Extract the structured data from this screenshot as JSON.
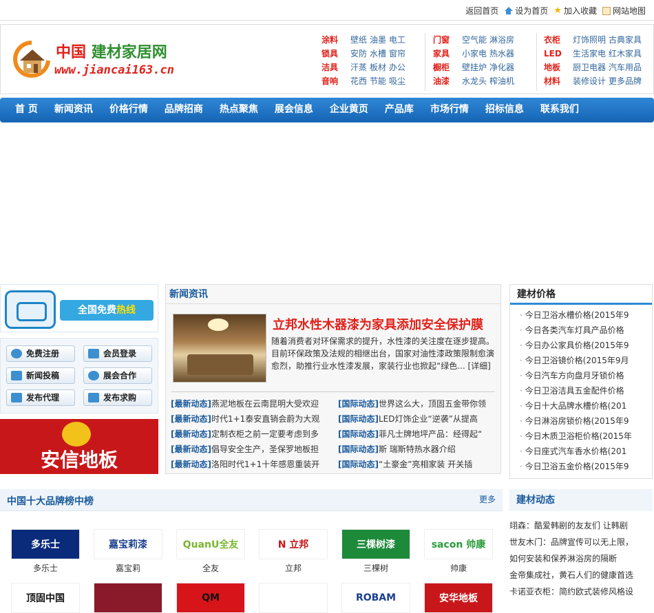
{
  "topbar": {
    "links": [
      "返回首页",
      "设为首页",
      "加入收藏",
      "网站地图"
    ]
  },
  "logo": {
    "title_red": "中国",
    "title_green": "建材家居网",
    "url": "www.jiancai163.cn"
  },
  "categories": [
    {
      "rows": [
        {
          "key": "涂料",
          "items": [
            "壁纸",
            "油墨",
            "电工"
          ]
        },
        {
          "key": "锁具",
          "items": [
            "安防",
            "水槽",
            "窗帘"
          ]
        },
        {
          "key": "洁具",
          "items": [
            "汗蒸",
            "板材",
            "办公"
          ]
        },
        {
          "key": "音响",
          "items": [
            "花西",
            "节能",
            "吸尘"
          ]
        }
      ]
    },
    {
      "rows": [
        {
          "key": "门窗",
          "items": [
            "空气能",
            "淋浴房"
          ]
        },
        {
          "key": "家具",
          "items": [
            "小家电",
            "热水器"
          ]
        },
        {
          "key": "橱柜",
          "items": [
            "壁挂炉",
            "净化器"
          ]
        },
        {
          "key": "油漆",
          "items": [
            "水龙头",
            "榨油机"
          ]
        }
      ]
    },
    {
      "rows": [
        {
          "key": "衣柜",
          "items": [
            "灯饰照明",
            "古典家具"
          ]
        },
        {
          "key": "LED",
          "items": [
            "生活家电",
            "红木家具"
          ]
        },
        {
          "key": "地板",
          "items": [
            "厨卫电器",
            "汽车用品"
          ]
        },
        {
          "key": "材料",
          "items": [
            "装修设计",
            "更多品牌"
          ]
        }
      ]
    }
  ],
  "nav": [
    "首 页",
    "新闻资讯",
    "价格行情",
    "品牌招商",
    "热点聚焦",
    "展会信息",
    "企业黄页",
    "产品库",
    "市场行情",
    "招标信息",
    "联系我们"
  ],
  "hotline": {
    "text_white": "全国免费",
    "text_yellow": "热线"
  },
  "user_buttons": [
    "免费注册",
    "会员登录",
    "新闻投稿",
    "展会合作",
    "发布代理",
    "发布求购"
  ],
  "anxin": {
    "brand": "安信地板"
  },
  "news": {
    "title": "新闻资讯",
    "featured_title": "立邦水性木器漆为家具添加安全保护膜",
    "featured_desc": "随着消费者对环保需求的提升，水性漆的关注度在逐步提高。目前环保政策及法规的相继出台，国家对油性漆政策限制愈演愈烈，助推行业水性漆发展，家装行业也掀起“绿色... [详细]",
    "left": [
      {
        "tag": "[最新动态]",
        "text": "燕泥地板在云南昆明大受欢迎"
      },
      {
        "tag": "[最新动态]",
        "text": "时代1+1泰安直销会蔚为大观"
      },
      {
        "tag": "[最新动态]",
        "text": "定制衣柜之前一定要考虑到多"
      },
      {
        "tag": "[最新动态]",
        "text": "倡导安全生产，圣保罗地板担"
      },
      {
        "tag": "[最新动态]",
        "text": "洛阳时代1+1十年感恩重装开"
      }
    ],
    "right": [
      {
        "tag": "[国际动态]",
        "text": "世界这么大，顶固五金带你领"
      },
      {
        "tag": "[国际动态]",
        "text": "LED灯饰企业“逆袭”从提高"
      },
      {
        "tag": "[国际动态]",
        "text": "菲凡士牌地坪产品：经得起“"
      },
      {
        "tag": "[国际动态]",
        "text": "斯 瑞斯特热水器介绍"
      },
      {
        "tag": "[国际动态]",
        "text": "“土豪金”亮相家装 开关插"
      }
    ]
  },
  "prices": {
    "title": "建材价格",
    "items": [
      "今日卫浴水槽价格(2015年9",
      "今日各类汽车灯具产品价格",
      "今日办公家具价格(2015年9",
      "今日卫浴镜价格(2015年9月",
      "今日汽车方向盘月牙锁价格",
      "今日卫浴洁具五金配件价格",
      "今日十大品牌水槽价格(201",
      "今日淋浴房锁价格(2015年9",
      "今日木质卫浴柜价格(2015年",
      "今日座式汽车香水价格(201",
      "今日卫浴五金价格(2015年9"
    ]
  },
  "dynamics": {
    "title": "建材动态",
    "items": [
      "翊森：酷爱韩剧的友友们 让韩剧",
      "世友木门：品牌宣传可以无上限，",
      "如何安装和保养淋浴房的隔断",
      "金帝集成社，黄石人们的健康首选",
      "卡诺亚衣柜：简约欧式装修风格设"
    ]
  },
  "brands": {
    "title": "中国十大品牌榜中榜",
    "more": "更多",
    "row1": [
      {
        "name": "多乐士",
        "logo_text": "多乐士",
        "bg": "#0a2a7a",
        "fg": "#ffffff"
      },
      {
        "name": "嘉宝莉",
        "logo_text": "嘉宝莉漆",
        "bg": "#ffffff",
        "fg": "#1a3f8f"
      },
      {
        "name": "全友",
        "logo_text": "QuanU全友",
        "bg": "#ffffff",
        "fg": "#7ab52e"
      },
      {
        "name": "立邦",
        "logo_text": "N 立邦",
        "bg": "#ffffff",
        "fg": "#c8171a"
      },
      {
        "name": "三棵树",
        "logo_text": "三棵树漆",
        "bg": "#1d8a3a",
        "fg": "#ffffff"
      },
      {
        "name": "帅康",
        "logo_text": "sacon 帅康",
        "bg": "#ffffff",
        "fg": "#2a9a3a"
      }
    ],
    "row2": [
      {
        "logo_text": "顶固中国",
        "bg": "#ffffff",
        "fg": "#111111"
      },
      {
        "logo_text": "",
        "bg": "#8a1a2a",
        "fg": "#ffffff"
      },
      {
        "logo_text": "QM",
        "bg": "#d8141b",
        "fg": "#111111"
      },
      {
        "logo_text": "",
        "bg": "#ffffff",
        "fg": "#2aa0d8"
      },
      {
        "logo_text": "ROBAM",
        "bg": "#ffffff",
        "fg": "#1a3f8f"
      },
      {
        "logo_text": "安华地板",
        "bg": "#c8171a",
        "fg": "#ffffff"
      }
    ]
  }
}
